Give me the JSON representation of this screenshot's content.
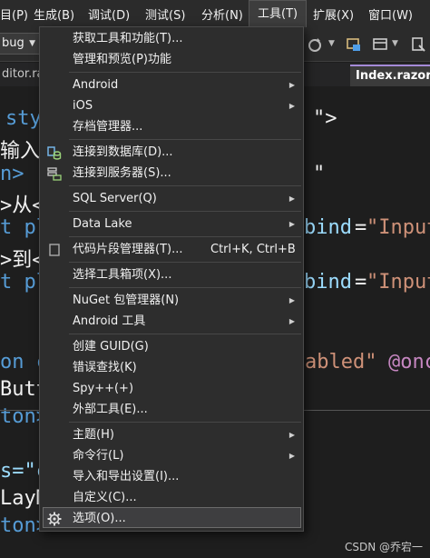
{
  "menubar": {
    "items": [
      "目(P)",
      "生成(B)",
      "调试(D)",
      "测试(S)",
      "分析(N)",
      "工具(T)",
      "扩展(X)",
      "窗口(W)"
    ]
  },
  "toolbar": {
    "config": "bug"
  },
  "tabs": {
    "left": "ditor.raz",
    "right": "Index.razor"
  },
  "code": {
    "l1a": "sty",
    "l1b": "\">",
    "l2": "输入范",
    "l3a": "n>",
    "l3b": "\"",
    "l4": ">从<",
    "l5a": "t pl",
    "l5b": "bind",
    "l5c": "=",
    "l5d": "\"Input",
    "l6": ">到<",
    "l7a": "t pl",
    "l7b": "bind",
    "l7c": "=",
    "l7d": "\"Input",
    "l8a": "on c",
    "l8b": "abled\"",
    "l8c": "@onc",
    "l9": "Butt",
    "l10": "ton>",
    "l11a": "s=\"c",
    "l12": "LayM",
    "l13": "ton>"
  },
  "menu": {
    "items": [
      {
        "label": "获取工具和功能(T)..."
      },
      {
        "label": "管理和预览(P)功能"
      },
      {
        "label": "Android"
      },
      {
        "label": "iOS"
      },
      {
        "label": "存档管理器..."
      },
      {
        "label": "连接到数据库(D)..."
      },
      {
        "label": "连接到服务器(S)..."
      },
      {
        "label": "SQL Server(Q)"
      },
      {
        "label": "Data Lake"
      },
      {
        "label": "代码片段管理器(T)...",
        "shortcut": "Ctrl+K, Ctrl+B"
      },
      {
        "label": "选择工具箱项(X)..."
      },
      {
        "label": "NuGet 包管理器(N)"
      },
      {
        "label": "Android 工具"
      },
      {
        "label": "创建 GUID(G)"
      },
      {
        "label": "错误查找(K)"
      },
      {
        "label": "Spy++(+)"
      },
      {
        "label": "外部工具(E)..."
      },
      {
        "label": "主题(H)"
      },
      {
        "label": "命令行(L)"
      },
      {
        "label": "导入和导出设置(I)..."
      },
      {
        "label": "自定义(C)..."
      },
      {
        "label": "选项(O)..."
      }
    ]
  },
  "watermark": "CSDN @乔宕一"
}
